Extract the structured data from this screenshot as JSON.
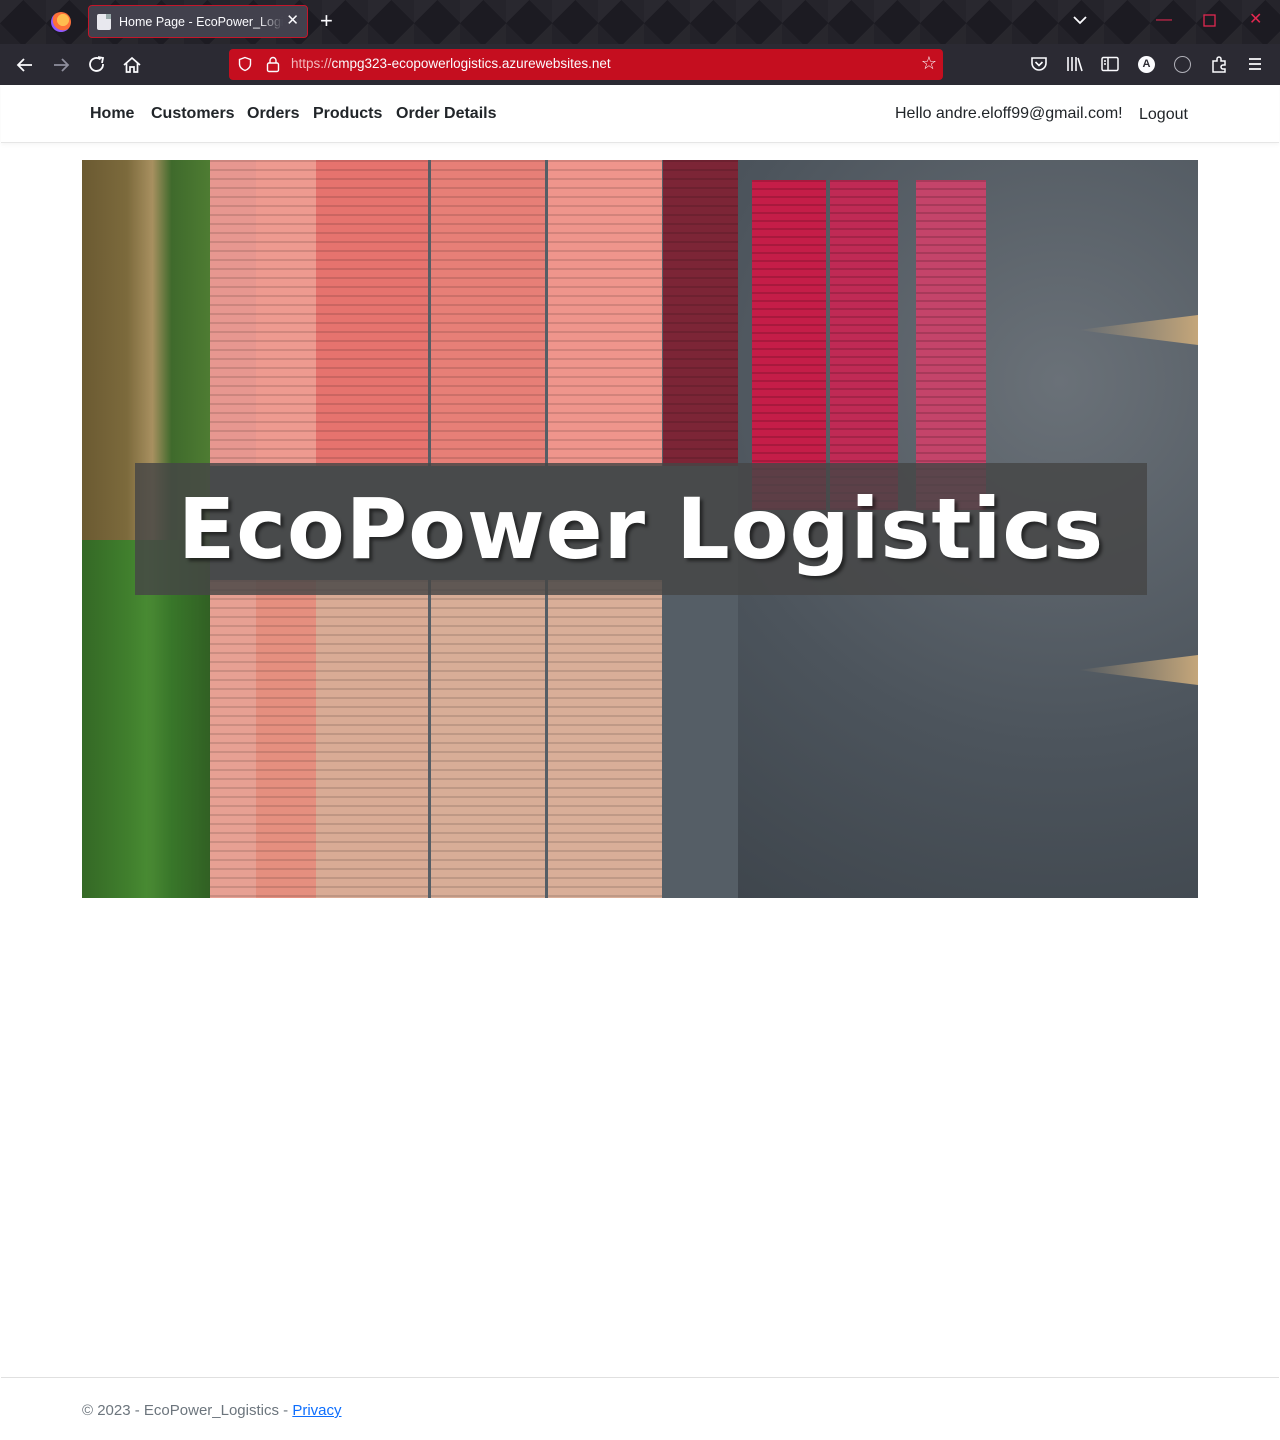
{
  "browser": {
    "tab": {
      "title": "Home Page - EcoPower_Logistics"
    },
    "url": {
      "scheme": "https://",
      "host": "cmpg323-ecopowerlogistics.azurewebsites.net"
    }
  },
  "site": {
    "nav": {
      "links": [
        "Home",
        "Customers",
        "Orders",
        "Products",
        "Order Details"
      ],
      "greeting": "Hello andre.eloff99@gmail.com!",
      "logout": "Logout"
    },
    "hero": {
      "title": "EcoPower Logistics"
    },
    "footer": {
      "text": "© 2023 - EcoPower_Logistics - ",
      "privacy": "Privacy"
    }
  },
  "colors": {
    "url_bar": "#c50e1f",
    "link": "#0d6efd"
  }
}
